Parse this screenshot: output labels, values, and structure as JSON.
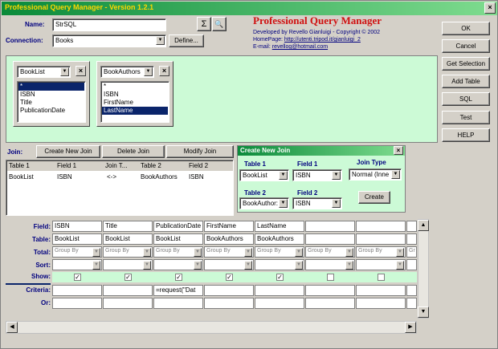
{
  "window": {
    "title": "Professional Query Manager - Version 1.2.1"
  },
  "header": {
    "name_label": "Name:",
    "name_value": "StrSQL",
    "connection_label": "Connection:",
    "connection_value": "Books",
    "define_label": "Define...",
    "sigma_label": "Σ",
    "search_label": "🔍"
  },
  "logo": {
    "title": "Professional Query Manager",
    "line1": "Developed by Revello Gianluigi - Copyright © 2002",
    "homepage_label": "HomePage: ",
    "homepage_url": "http://utenti.tripod.it/gianluigi_2",
    "email_label": "E-mail: ",
    "email_value": "revellog@hotmail.com"
  },
  "side_buttons": [
    "OK",
    "Cancel",
    "Get Selection",
    "Add Table",
    "SQL",
    "Test",
    "HELP"
  ],
  "tables": [
    {
      "name": "BookList",
      "fields": [
        "*",
        "ISBN",
        "Title",
        "PublicationDate"
      ],
      "selected": 0
    },
    {
      "name": "BookAuthors",
      "fields": [
        "*",
        "ISBN",
        "FirstName",
        "LastName"
      ],
      "selected": 3
    }
  ],
  "join": {
    "label": "Join:",
    "buttons": [
      "Create New Join",
      "Delete Join",
      "Modify Join"
    ],
    "columns": [
      "Table 1",
      "Field 1",
      "Join T...",
      "Table 2",
      "Field 2"
    ],
    "rows": [
      [
        "BookList",
        "ISBN",
        "<->",
        "BookAuthors",
        "ISBN"
      ]
    ]
  },
  "create_join": {
    "title": "Create New Join",
    "table1_label": "Table 1",
    "table1_value": "BookList",
    "field1_label": "Field 1",
    "field1_value": "ISBN",
    "jointype_label": "Join Type",
    "jointype_value": "Normal (Inne",
    "table2_label": "Table 2",
    "table2_value": "BookAuthor:",
    "field2_label": "Field 2",
    "field2_value": "ISBN",
    "create_label": "Create"
  },
  "grid": {
    "row_labels": [
      "Field:",
      "Table:",
      "Total:",
      "Sort:",
      "Show:",
      "Criteria:",
      "Or:"
    ],
    "fields": [
      "ISBN",
      "Title",
      "PublicationDate",
      "FirstName",
      "LastName",
      "",
      "",
      ""
    ],
    "tables": [
      "BookList",
      "BookList",
      "BookList",
      "BookAuthors",
      "BookAuthors",
      "",
      "",
      ""
    ],
    "total": [
      "Group By",
      "Group By",
      "Group By",
      "Group By",
      "Group By",
      "Group By",
      "Group By",
      "Gr"
    ],
    "show": [
      true,
      true,
      true,
      true,
      true,
      false,
      false,
      false
    ],
    "criteria": [
      "",
      "",
      "=request(\"Dat",
      "",
      "",
      "",
      "",
      ""
    ]
  }
}
